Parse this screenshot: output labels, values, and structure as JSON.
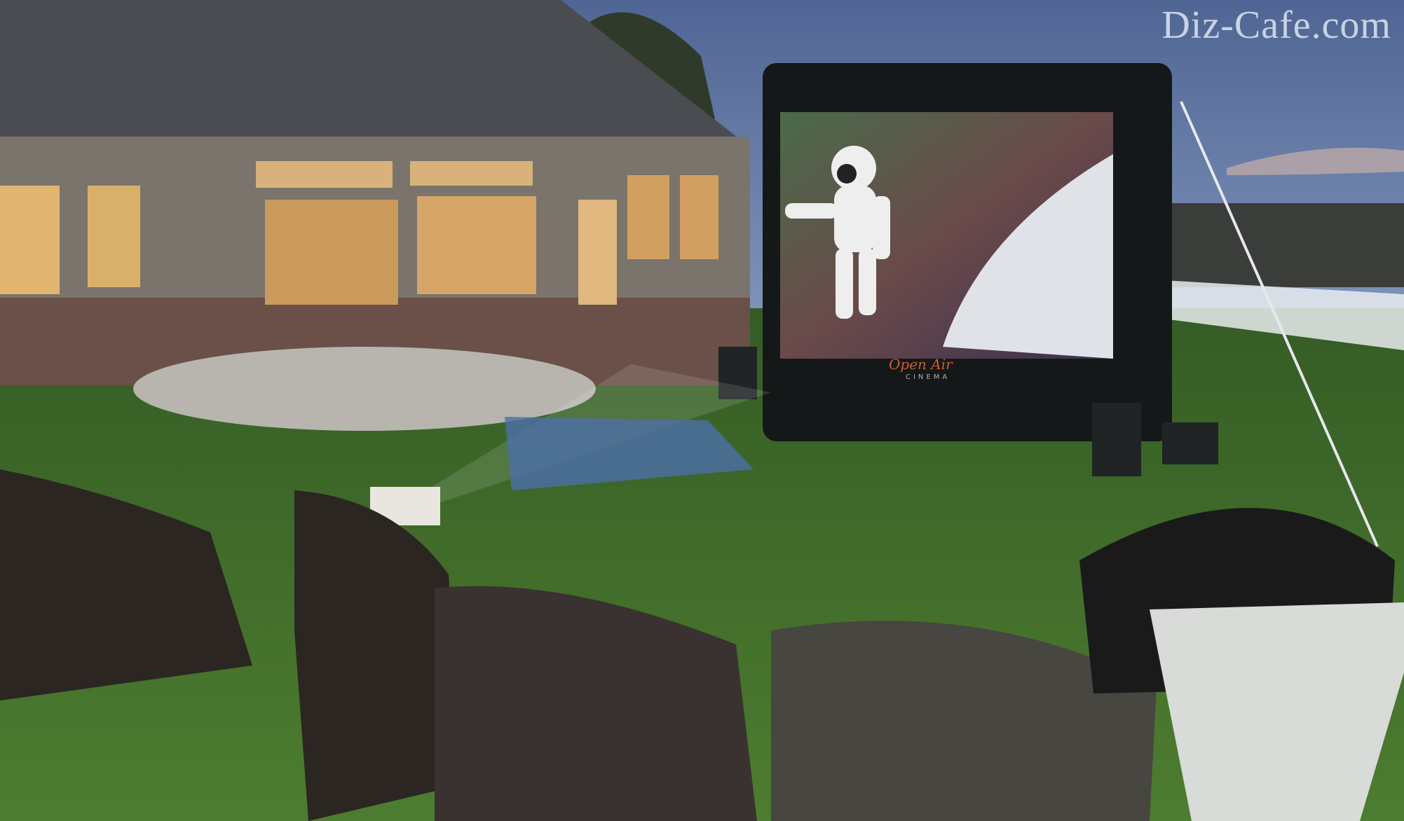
{
  "watermark": "Diz-Cafe.com",
  "screen_logo": {
    "line1": "Open Air",
    "line2": "CINEMA"
  },
  "colors": {
    "sky": "#5f7aa8",
    "grass": "#3f6a2a",
    "house": "#6e6a66",
    "roof": "#4a4c52",
    "screen_frame": "#151818"
  }
}
